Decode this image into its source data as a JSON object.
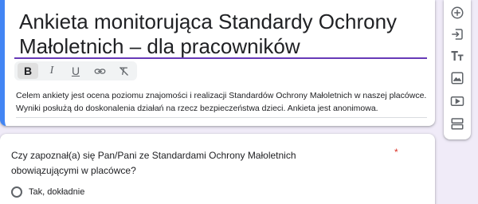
{
  "form": {
    "title": " Ankieta monitorująca Standardy Ochrony Małoletnich – dla pracowników",
    "description": " Celem ankiety jest ocena poziomu znajomości i realizacji Standardów Ochrony Małoletnich w naszej placówce. Wyniki posłużą do doskonalenia działań na rzecz bezpieczeństwa dzieci. Ankieta jest anonimowa.",
    "accent_color": "#673ab7",
    "focus_color": "#4285f4",
    "background_color": "#f0ebf8"
  },
  "format_toolbar": {
    "bold_label": "B",
    "italic_label": "I",
    "underline_label": "U",
    "icons": [
      "bold-icon",
      "italic-icon",
      "underline-icon",
      "link-icon",
      "clear-format-icon"
    ]
  },
  "side_toolbar": {
    "icons": [
      "add-question-icon",
      "import-questions-icon",
      "add-title-icon",
      "add-image-icon",
      "add-video-icon",
      "add-section-icon"
    ]
  },
  "question": {
    "text": "Czy zapoznał(a) się Pan/Pani ze Standardami Ochrony Małoletnich obowiązującymi w placówce?",
    "required_mark": "*",
    "options": [
      "Tak, dokładnie"
    ]
  }
}
